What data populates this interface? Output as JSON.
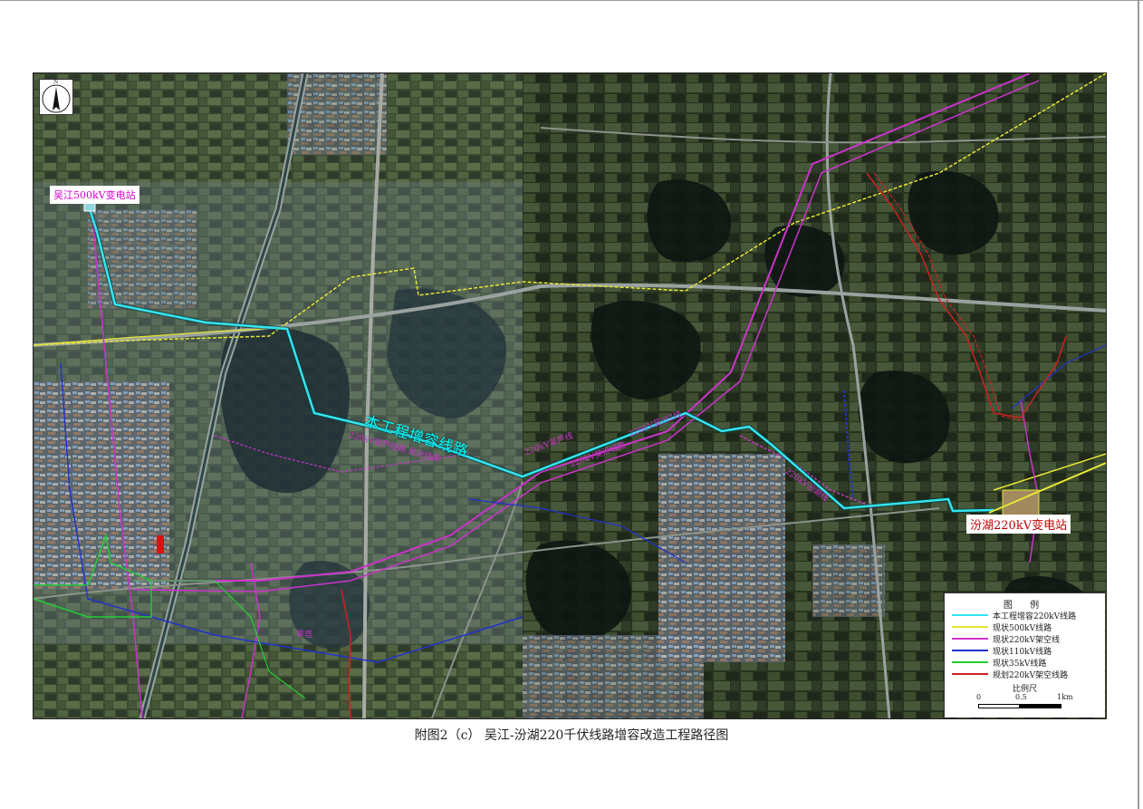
{
  "map": {
    "north_letter": "N",
    "stations": {
      "a": "吴江500kV变电站",
      "b": "汾湖220kV变电站"
    },
    "route_label": "本工程增容线路",
    "line_labels": [
      "220kV吴芦线路 吴汾线路",
      "220kV吴汾线路",
      "220kV吴芦线",
      "220kV吴汾2线",
      "220kV汾湖线",
      "莘塔"
    ],
    "colors": {
      "route": "#33e5f0",
      "line_500": "#e6e633",
      "line_220": "#cc33cc",
      "line_110": "#2233cc",
      "line_35": "#22cc33",
      "planned_220": "#cc2222"
    }
  },
  "legend": {
    "title": "图 例",
    "items": [
      {
        "label": "本工程增容220kV线路",
        "color": "#33e5f0"
      },
      {
        "label": "现状500kV线路",
        "color": "#e6e633"
      },
      {
        "label": "现状220kV架空线",
        "color": "#cc33cc"
      },
      {
        "label": "现状110kV线路",
        "color": "#2233cc"
      },
      {
        "label": "现状35kV线路",
        "color": "#22cc33"
      },
      {
        "label": "规划220kV架空线路",
        "color": "#cc2222"
      }
    ],
    "scale": {
      "title": "比例尺",
      "ticks": [
        "0",
        "0.5",
        "1km"
      ]
    }
  },
  "caption": "附图2（c） 吴江-汾湖220千伏线路增容改造工程路径图"
}
